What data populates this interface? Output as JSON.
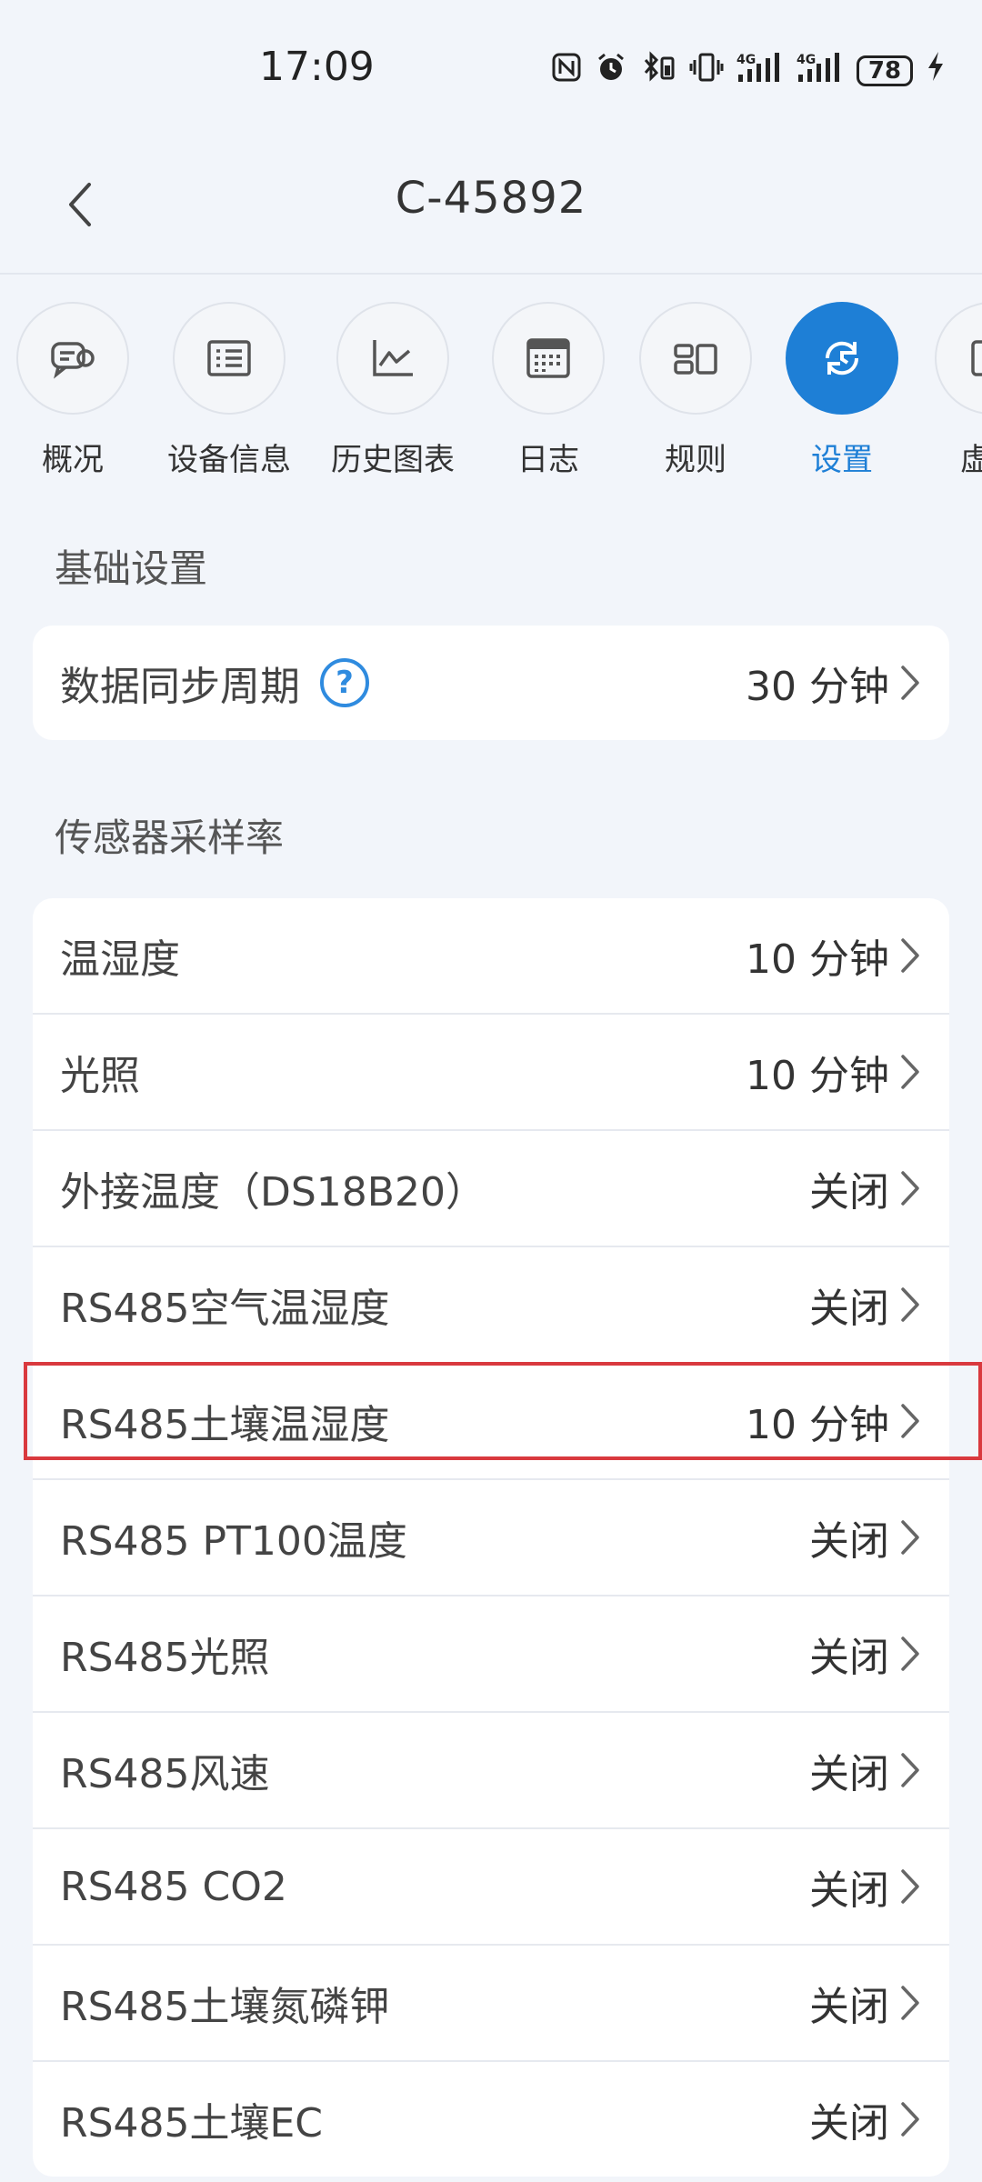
{
  "status_bar": {
    "time": "17:09",
    "signal1": "4G",
    "signal2": "4G",
    "battery": "78"
  },
  "nav": {
    "title": "C-45892"
  },
  "tabs": [
    {
      "label": "概况",
      "icon": "overview-icon",
      "active": false
    },
    {
      "label": "设备信息",
      "icon": "device-info-icon",
      "active": false
    },
    {
      "label": "历史图表",
      "icon": "history-chart-icon",
      "active": false
    },
    {
      "label": "日志",
      "icon": "log-calendar-icon",
      "active": false
    },
    {
      "label": "规则",
      "icon": "rules-icon",
      "active": false
    },
    {
      "label": "设置",
      "icon": "settings-sync-icon",
      "active": true
    },
    {
      "label": "虚拟",
      "icon": "virtual-icon",
      "active": false
    }
  ],
  "basic": {
    "title": "基础设置",
    "sync_label": "数据同步周期",
    "sync_value": "30 分钟",
    "help": "?"
  },
  "sensors": {
    "title": "传感器采样率",
    "items": [
      {
        "label": "温湿度",
        "value": "10 分钟"
      },
      {
        "label": "光照",
        "value": "10 分钟"
      },
      {
        "label": "外接温度（DS18B20）",
        "value": "关闭"
      },
      {
        "label": "RS485空气温湿度",
        "value": "关闭"
      },
      {
        "label": "RS485土壤温湿度",
        "value": "10 分钟"
      },
      {
        "label": "RS485 PT100温度",
        "value": "关闭"
      },
      {
        "label": "RS485光照",
        "value": "关闭"
      },
      {
        "label": "RS485风速",
        "value": "关闭"
      },
      {
        "label": "RS485 CO2",
        "value": "关闭"
      },
      {
        "label": "RS485土壤氮磷钾",
        "value": "关闭"
      },
      {
        "label": "RS485土壤EC",
        "value": "关闭"
      }
    ]
  },
  "colors": {
    "accent": "#1e7fd6",
    "highlight": "#d9393e",
    "background": "#f2f5fa"
  }
}
